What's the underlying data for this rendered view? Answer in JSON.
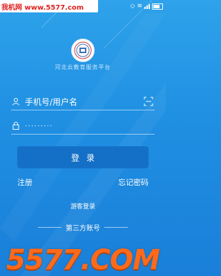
{
  "watermark_top": "我机网 www.5577.com",
  "app": {
    "title": "河北云教育服务平台"
  },
  "form": {
    "username_placeholder": "手机号/用户名",
    "password_masked": "·········",
    "login_label": "登录",
    "register_label": "注册",
    "forgot_label": "忘记密码",
    "guest_label": "游客登录",
    "third_party_label": "第三方账号"
  },
  "watermark_bottom": "5577.COM",
  "icons": {
    "user": "user-icon",
    "lock": "lock-icon",
    "scan": "scan-icon",
    "logo": "logo-icon"
  }
}
